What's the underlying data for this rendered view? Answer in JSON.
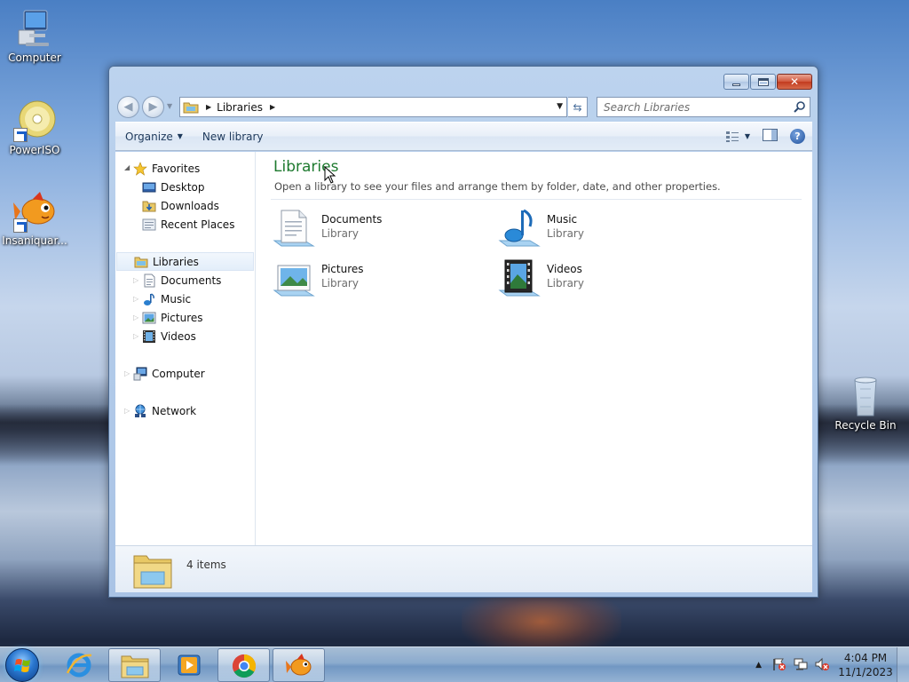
{
  "desktop": {
    "icons": [
      {
        "label": "Computer"
      },
      {
        "label": "PowerISO"
      },
      {
        "label": "Insaniquar..."
      },
      {
        "label": "Recycle Bin"
      }
    ]
  },
  "window": {
    "address": {
      "crumb": "Libraries"
    },
    "search": {
      "placeholder": "Search Libraries"
    },
    "toolbar": {
      "organize_label": "Organize",
      "new_library_label": "New library"
    },
    "nav_pane": {
      "favorites": {
        "label": "Favorites",
        "items": [
          {
            "label": "Desktop"
          },
          {
            "label": "Downloads"
          },
          {
            "label": "Recent Places"
          }
        ]
      },
      "libraries": {
        "label": "Libraries",
        "items": [
          {
            "label": "Documents"
          },
          {
            "label": "Music"
          },
          {
            "label": "Pictures"
          },
          {
            "label": "Videos"
          }
        ]
      },
      "computer": {
        "label": "Computer"
      },
      "network": {
        "label": "Network"
      }
    },
    "content": {
      "title": "Libraries",
      "subtitle": "Open a library to see your files and arrange them by folder, date, and other properties.",
      "libraries": [
        {
          "name": "Documents",
          "type": "Library"
        },
        {
          "name": "Music",
          "type": "Library"
        },
        {
          "name": "Pictures",
          "type": "Library"
        },
        {
          "name": "Videos",
          "type": "Library"
        }
      ]
    },
    "details": {
      "count": "4 items"
    }
  },
  "taskbar": {
    "clock": {
      "time": "4:04 PM",
      "date": "11/1/2023"
    }
  },
  "colors": {
    "title_green": "#1e7a2f",
    "command_text": "#1e395b",
    "selection_bg": "#e3eefa"
  }
}
